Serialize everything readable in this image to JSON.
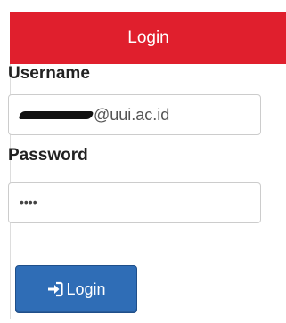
{
  "panel": {
    "title": "Login",
    "header_color": "#e01f2d"
  },
  "form": {
    "username_label": "Username",
    "username_value_suffix": "@uui.ac.id",
    "password_label": "Password",
    "password_mask": "••••"
  },
  "button": {
    "label": "Login",
    "icon": "sign-in-icon",
    "color": "#2f6db6"
  }
}
